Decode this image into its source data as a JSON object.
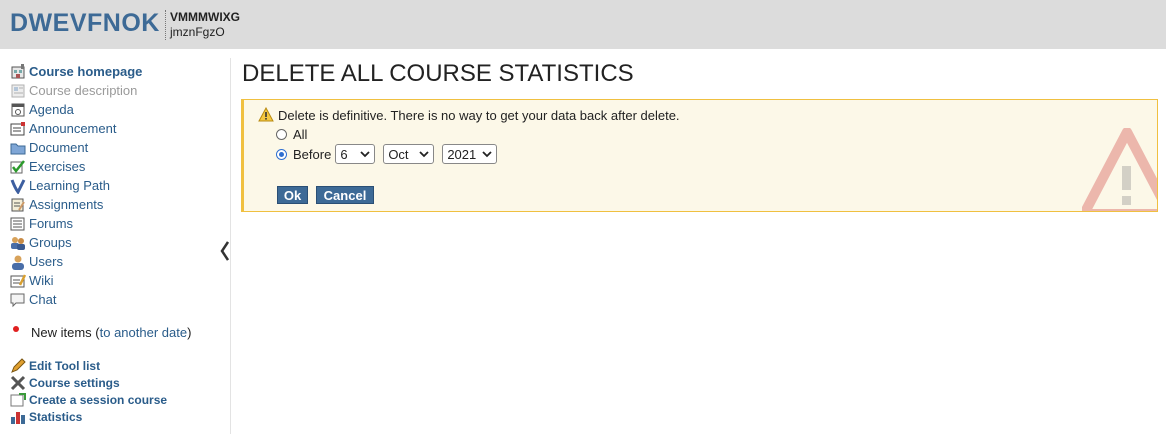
{
  "header": {
    "course_code": "DWEVFNOK",
    "course_title": "VMMMWIXG",
    "course_owner": "jmznFgzO"
  },
  "sidebar": {
    "tools": [
      {
        "label": "Course homepage",
        "icon": "home-icon",
        "style": "strong"
      },
      {
        "label": "Course description",
        "icon": "description-icon",
        "style": "disabled"
      },
      {
        "label": "Agenda",
        "icon": "calendar-icon",
        "style": "normal"
      },
      {
        "label": "Announcement",
        "icon": "announcement-icon",
        "style": "normal"
      },
      {
        "label": "Document",
        "icon": "folder-icon",
        "style": "normal"
      },
      {
        "label": "Exercises",
        "icon": "checkmark-icon",
        "style": "normal"
      },
      {
        "label": "Learning Path",
        "icon": "learning-path-icon",
        "style": "normal"
      },
      {
        "label": "Assignments",
        "icon": "assignment-icon",
        "style": "normal"
      },
      {
        "label": "Forums",
        "icon": "forum-icon",
        "style": "normal"
      },
      {
        "label": "Groups",
        "icon": "group-icon",
        "style": "normal"
      },
      {
        "label": "Users",
        "icon": "user-icon",
        "style": "normal"
      },
      {
        "label": "Wiki",
        "icon": "wiki-icon",
        "style": "normal"
      },
      {
        "label": "Chat",
        "icon": "chat-icon",
        "style": "normal"
      }
    ],
    "new_items_label": "New items (",
    "new_items_link": "to another date",
    "new_items_suffix": ")",
    "admin": [
      {
        "label": "Edit Tool list",
        "icon": "pencil-icon"
      },
      {
        "label": "Course settings",
        "icon": "settings-icon"
      },
      {
        "label": "Create a session course",
        "icon": "session-icon"
      },
      {
        "label": "Statistics",
        "icon": "statistics-icon"
      }
    ]
  },
  "main": {
    "title": "DELETE ALL COURSE STATISTICS",
    "warning": "Delete is definitive. There is no way to get your data back after delete.",
    "option_all": "All",
    "option_before": "Before",
    "selected_option": "before",
    "day": "6",
    "month": "Oct",
    "year": "2021",
    "ok_label": "Ok",
    "cancel_label": "Cancel"
  },
  "colors": {
    "accent": "#3d6a96",
    "link": "#2a5c8a",
    "warning_border": "#f0c040",
    "warning_bg": "#fcf8e8"
  }
}
